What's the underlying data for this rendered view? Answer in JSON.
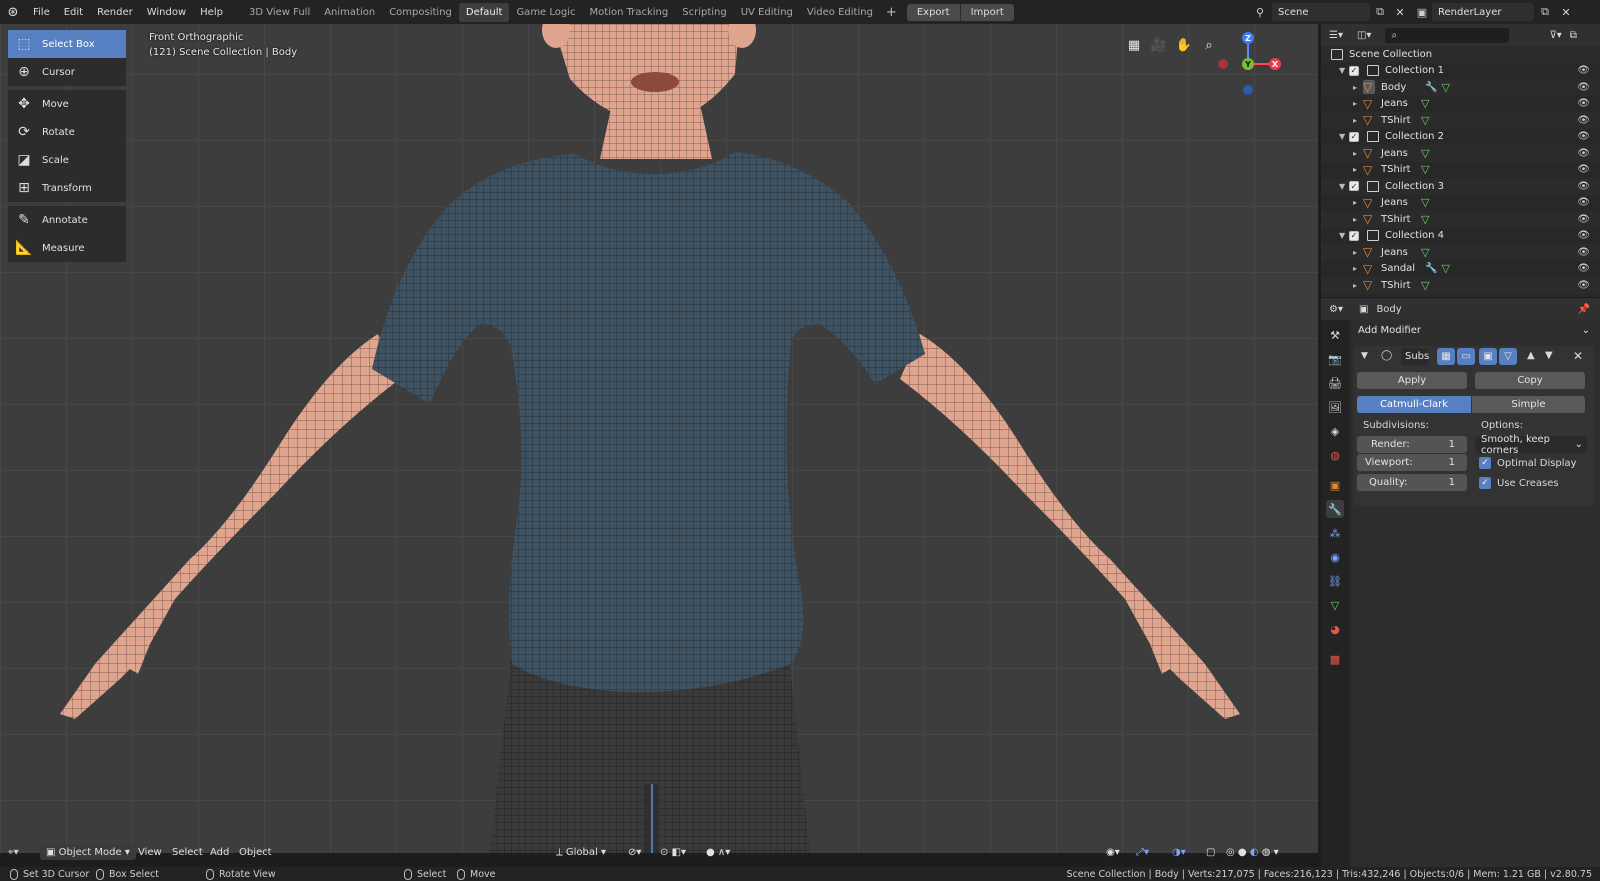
{
  "menus": [
    "File",
    "Edit",
    "Render",
    "Window",
    "Help"
  ],
  "workspaces": [
    {
      "label": "3D View Full",
      "active": false
    },
    {
      "label": "Animation",
      "active": false
    },
    {
      "label": "Compositing",
      "active": false
    },
    {
      "label": "Default",
      "active": true
    },
    {
      "label": "Game Logic",
      "active": false
    },
    {
      "label": "Motion Tracking",
      "active": false
    },
    {
      "label": "Scripting",
      "active": false
    },
    {
      "label": "UV Editing",
      "active": false
    },
    {
      "label": "Video Editing",
      "active": false
    }
  ],
  "add_workspace": "+",
  "export_label": "Export",
  "import_label": "Import",
  "scene_name": "Scene",
  "render_layer": "RenderLayer",
  "viewport": {
    "view_name": "Front Orthographic",
    "collection_info": "(121) Scene Collection | Body"
  },
  "tools": [
    {
      "label": "Select Box",
      "icon": "select-box-icon",
      "glyph": "⬚",
      "active": true
    },
    {
      "label": "Cursor",
      "icon": "cursor-icon",
      "glyph": "⊕",
      "active": false
    },
    {
      "label": "Move",
      "icon": "move-icon",
      "glyph": "✥",
      "active": false
    },
    {
      "label": "Rotate",
      "icon": "rotate-icon",
      "glyph": "⟳",
      "active": false
    },
    {
      "label": "Scale",
      "icon": "scale-icon",
      "glyph": "◪",
      "active": false
    },
    {
      "label": "Transform",
      "icon": "transform-icon",
      "glyph": "⊞",
      "active": false
    },
    {
      "label": "Annotate",
      "icon": "annotate-icon",
      "glyph": "✎",
      "active": false
    },
    {
      "label": "Measure",
      "icon": "measure-icon",
      "glyph": "📐",
      "active": false
    }
  ],
  "gizmo": {
    "z": "Z",
    "y": "Y",
    "x": "X"
  },
  "header": {
    "mode": "Object Mode",
    "view": "View",
    "select": "Select",
    "add": "Add",
    "object": "Object",
    "orientation": "Global"
  },
  "outliner": {
    "search_placeholder": "",
    "root": "Scene Collection",
    "rows": [
      {
        "type": "collection",
        "label": "Collection 1",
        "indent": 1
      },
      {
        "type": "mesh",
        "label": "Body",
        "indent": 2,
        "modifier": true,
        "selected": true
      },
      {
        "type": "mesh",
        "label": "Jeans",
        "indent": 2,
        "modifier": false
      },
      {
        "type": "mesh",
        "label": "TShirt",
        "indent": 2,
        "modifier": false
      },
      {
        "type": "collection",
        "label": "Collection 2",
        "indent": 1
      },
      {
        "type": "mesh",
        "label": "Jeans",
        "indent": 2,
        "modifier": false
      },
      {
        "type": "mesh",
        "label": "TShirt",
        "indent": 2,
        "modifier": false
      },
      {
        "type": "collection",
        "label": "Collection 3",
        "indent": 1
      },
      {
        "type": "mesh",
        "label": "Jeans",
        "indent": 2,
        "modifier": false
      },
      {
        "type": "mesh",
        "label": "TShirt",
        "indent": 2,
        "modifier": false
      },
      {
        "type": "collection",
        "label": "Collection 4",
        "indent": 1
      },
      {
        "type": "mesh",
        "label": "Jeans",
        "indent": 2,
        "modifier": false
      },
      {
        "type": "mesh",
        "label": "Sandal",
        "indent": 2,
        "modifier": true
      },
      {
        "type": "mesh",
        "label": "TShirt",
        "indent": 2,
        "modifier": false
      }
    ]
  },
  "properties": {
    "object_name": "Body",
    "add_modifier": "Add Modifier",
    "modifier_name": "Subs",
    "apply": "Apply",
    "copy": "Copy",
    "catmull": "Catmull-Clark",
    "simple": "Simple",
    "subdivisions_label": "Subdivisions:",
    "options_label": "Options:",
    "render_label": "Render:",
    "render_value": "1",
    "viewport_label": "Viewport:",
    "viewport_value": "1",
    "quality_label": "Quality:",
    "quality_value": "1",
    "uv_smooth": "Smooth, keep corners",
    "optimal_display": "Optimal Display",
    "use_creases": "Use Creases"
  },
  "statusbar": {
    "set_cursor": "Set 3D Cursor",
    "box_select": "Box Select",
    "rotate_view": "Rotate View",
    "select": "Select",
    "move": "Move",
    "stats": "Scene Collection | Body | Verts:217,075 | Faces:216,123 | Tris:432,246 | Objects:0/6 | Mem: 1.21 GB | v2.80.75"
  },
  "colors": {
    "accent": "#5680c2",
    "skin": "#e0a58e",
    "shirt": "#3f5262",
    "jeans": "#3a3a3a",
    "mesh_orange": "#e08a3a",
    "vgroup_green": "#6fd16f"
  }
}
